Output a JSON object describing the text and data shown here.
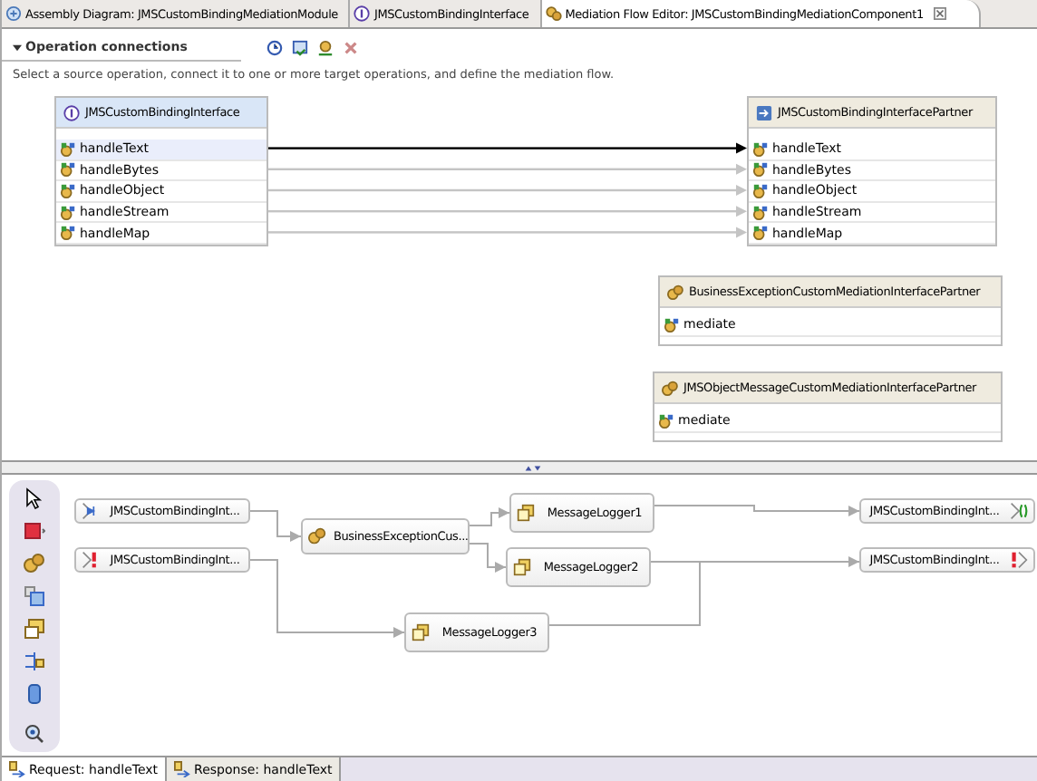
{
  "tabs": [
    {
      "label": "Assembly Diagram: JMSCustomBindingMediationModule",
      "kind": "diagram",
      "selected": false
    },
    {
      "label": "JMSCustomBindingInterface",
      "kind": "interface",
      "selected": false
    },
    {
      "label": "Mediation Flow Editor: JMSCustomBindingMediationComponent1",
      "kind": "flow",
      "selected": true
    }
  ],
  "section": {
    "title": "Operation connections",
    "description": "Select a source operation, connect it to one or more target operations, and define the mediation flow."
  },
  "source_interface": {
    "name": "JMSCustomBindingInterface",
    "operations": [
      {
        "name": "handleText",
        "selected": true
      },
      {
        "name": "handleBytes",
        "selected": false
      },
      {
        "name": "handleObject",
        "selected": false
      },
      {
        "name": "handleStream",
        "selected": false
      },
      {
        "name": "handleMap",
        "selected": false
      }
    ]
  },
  "target_interfaces": [
    {
      "name": "JMSCustomBindingInterfacePartner",
      "kind": "reference",
      "operations": [
        {
          "name": "handleText"
        },
        {
          "name": "handleBytes"
        },
        {
          "name": "handleObject"
        },
        {
          "name": "handleStream"
        },
        {
          "name": "handleMap"
        }
      ]
    },
    {
      "name": "BusinessExceptionCustomMediationInterfacePartner",
      "kind": "mediation",
      "operations": [
        {
          "name": "mediate"
        }
      ]
    },
    {
      "name": "JMSObjectMessageCustomMediationInterfacePartner",
      "kind": "mediation",
      "operations": [
        {
          "name": "mediate"
        }
      ]
    }
  ],
  "connections": [
    {
      "selected": true
    },
    {
      "selected": false
    },
    {
      "selected": false
    },
    {
      "selected": false
    },
    {
      "selected": false
    }
  ],
  "flow_nodes": [
    {
      "label": "JMSCustomBindingInt...",
      "kind": "input"
    },
    {
      "label": "JMSCustomBindingInt...",
      "kind": "input-fault"
    },
    {
      "label": "BusinessExceptionCus...",
      "kind": "custom"
    },
    {
      "label": "MessageLogger1",
      "kind": "logger"
    },
    {
      "label": "MessageLogger2",
      "kind": "logger"
    },
    {
      "label": "MessageLogger3",
      "kind": "logger"
    },
    {
      "label": "JMSCustomBindingInt...",
      "kind": "callout"
    },
    {
      "label": "JMSCustomBindingInt...",
      "kind": "callout-fault"
    }
  ],
  "bottom_tabs": [
    {
      "label": "Request: handleText",
      "selected": true
    },
    {
      "label": "Response: handleText",
      "selected": false
    }
  ]
}
